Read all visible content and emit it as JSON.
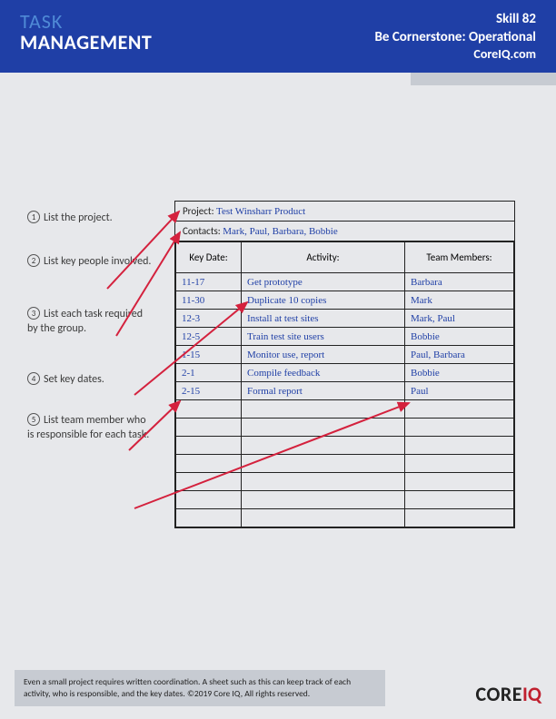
{
  "header": {
    "title_line1": "TASK",
    "title_line2": "MANAGEMENT",
    "skill": "Skill 82",
    "category": "Be Cornerstone: Operational",
    "site": "CoreIQ.com"
  },
  "callouts": [
    {
      "num": "1",
      "text": "List the project."
    },
    {
      "num": "2",
      "text": "List key people involved."
    },
    {
      "num": "3",
      "text": "List each task required by the group."
    },
    {
      "num": "4",
      "text": "Set key dates."
    },
    {
      "num": "5",
      "text": "List team member who is responsible for each task."
    }
  ],
  "sheet": {
    "project_label": "Project:",
    "project_value": "Test Winsharr Product",
    "contacts_label": "Contacts:",
    "contacts_value": "Mark, Paul, Barbara, Bobbie",
    "columns": {
      "date": "Key Date:",
      "activity": "Activity:",
      "team": "Team Members:"
    },
    "rows": [
      {
        "date": "11-17",
        "activity": "Get prototype",
        "team": "Barbara"
      },
      {
        "date": "11-30",
        "activity": "Duplicate 10 copies",
        "team": "Mark"
      },
      {
        "date": "12-3",
        "activity": "Install at test sites",
        "team": "Mark, Paul"
      },
      {
        "date": "12-5",
        "activity": "Train test site users",
        "team": "Bobbie"
      },
      {
        "date": "1-15",
        "activity": "Monitor use, report",
        "team": "Paul, Barbara"
      },
      {
        "date": "2-1",
        "activity": "Compile feedback",
        "team": "Bobbie"
      },
      {
        "date": "2-15",
        "activity": "Formal report",
        "team": "Paul"
      }
    ],
    "blank_rows": 7
  },
  "footer": {
    "note": "Even a small project requires written coordination. A sheet such as this can keep track of each activity, who is responsible, and the key dates. ©2019 Core IQ, All rights reserved.",
    "logo_core": "CORE",
    "logo_iq": "IQ"
  }
}
